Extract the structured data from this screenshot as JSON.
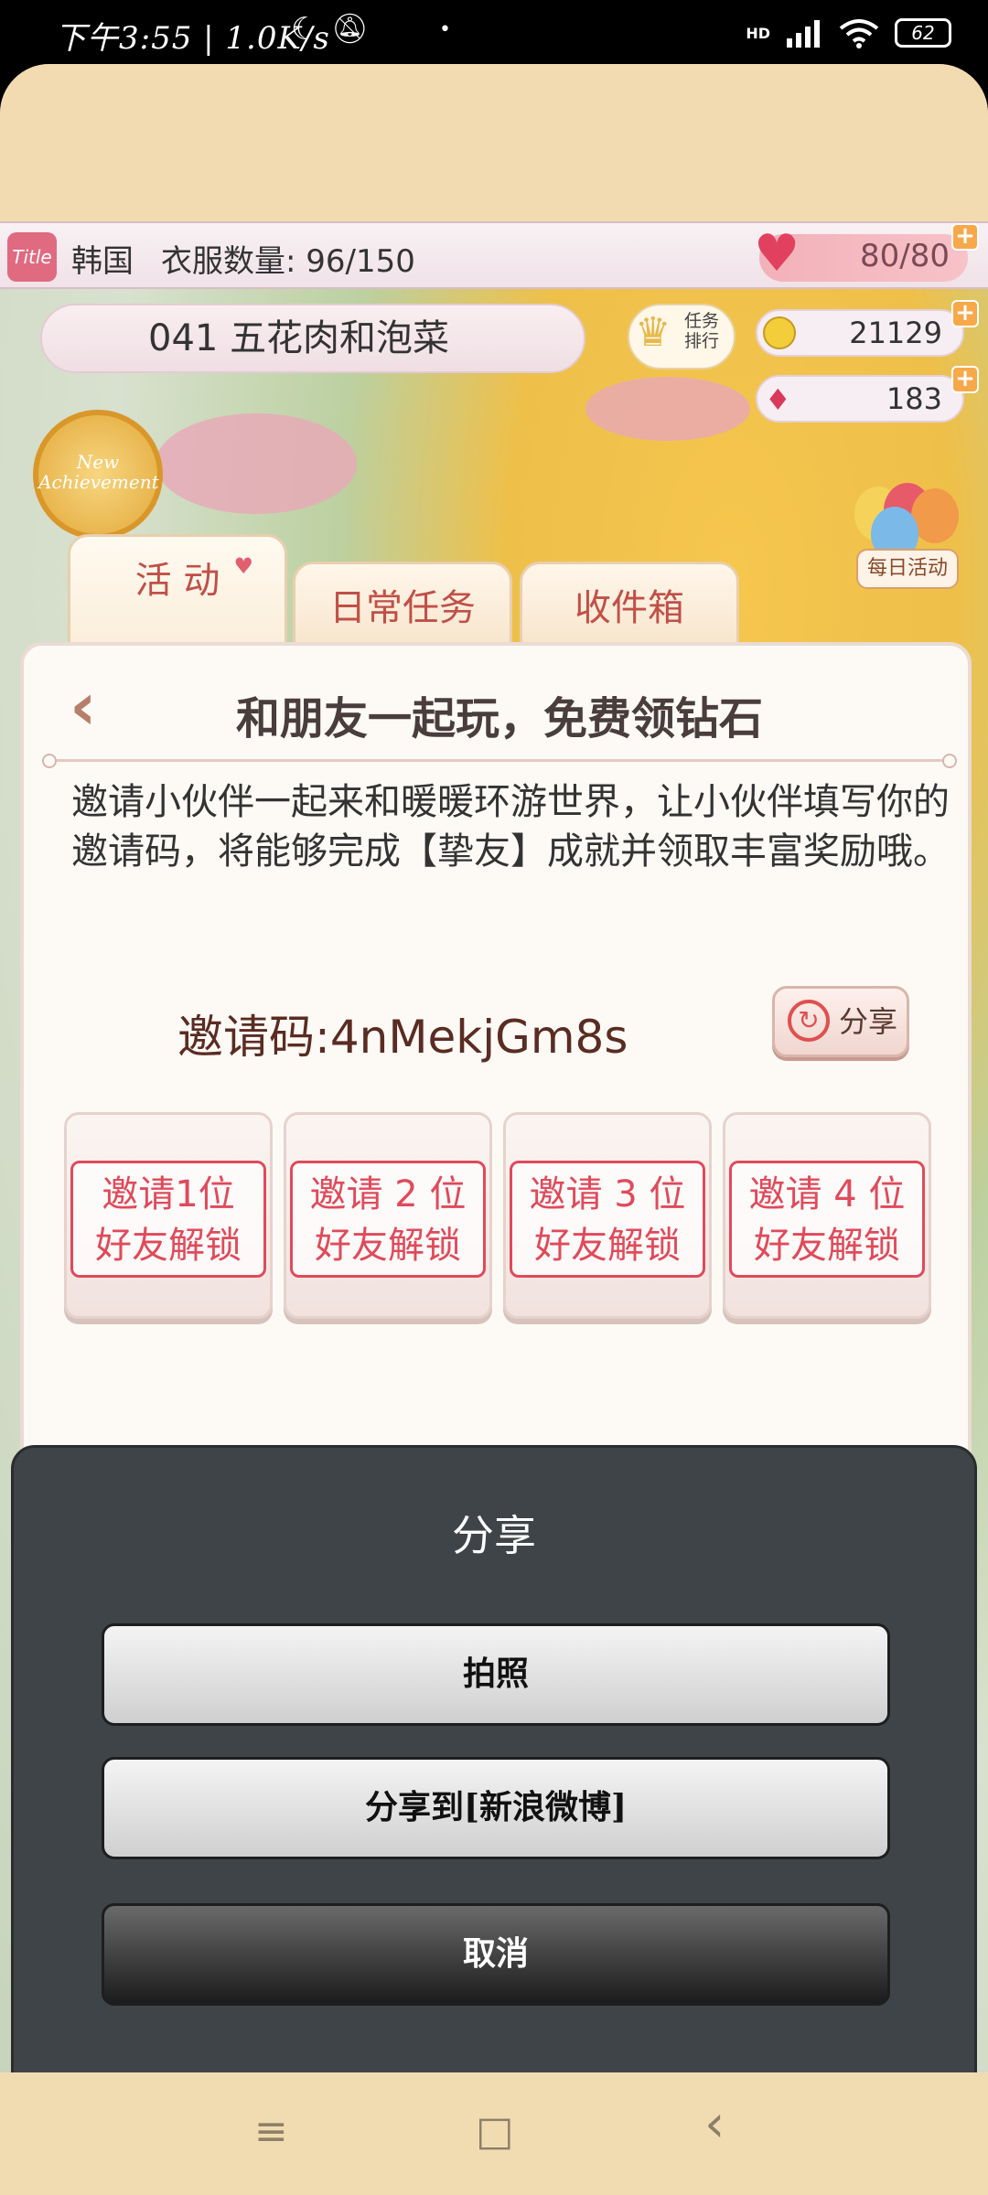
{
  "status_bar": {
    "left_text": "下午3:55 | 1.0K/s",
    "right_signal": "HD",
    "battery": "62",
    "icons": [
      "moon-icon",
      "mute-bell-icon",
      "signal-icon",
      "wifi-icon",
      "battery-icon"
    ]
  },
  "infobar": {
    "title_badge": "Title",
    "country": "韩国",
    "clothes_label": "衣服数量: 96/150",
    "hearts": "80/80",
    "plus": "+"
  },
  "level": {
    "name": "041 五花肉和泡菜"
  },
  "task_rank": {
    "label": "任务排行"
  },
  "currency": {
    "coins": "21129",
    "gems": "183"
  },
  "achievement": {
    "text": "New Achievement"
  },
  "daily_activity": {
    "label": "每日活动"
  },
  "tabs": [
    {
      "label": "活 动"
    },
    {
      "label": "日常任务"
    },
    {
      "label": "收件箱"
    }
  ],
  "panel": {
    "back": "‹",
    "title": "和朋友一起玩，免费领钻石",
    "description": "邀请小伙伴一起来和暖暖环游世界，让小伙伴填写你的邀请码，将能够完成【挚友】成就并领取丰富奖励哦。",
    "invite_code": "邀请码:4nMekjGm8s",
    "share_label": "分享",
    "slots": [
      {
        "line1": "邀请1位",
        "line2": "好友解锁"
      },
      {
        "line1": "邀请 2 位",
        "line2": "好友解锁"
      },
      {
        "line1": "邀请 3 位",
        "line2": "好友解锁"
      },
      {
        "line1": "邀请 4 位",
        "line2": "好友解锁"
      }
    ]
  },
  "dialog": {
    "title": "分享",
    "buttons": {
      "photo": "拍照",
      "weibo": "分享到[新浪微博]",
      "cancel": "取消"
    }
  },
  "navbar": {
    "menu": "≡",
    "home": "□",
    "back": "‹"
  },
  "colors": {
    "accent_red": "#e04a5a",
    "dialog_bg": "#3f4448",
    "nav_bg": "#f1dcb2"
  }
}
